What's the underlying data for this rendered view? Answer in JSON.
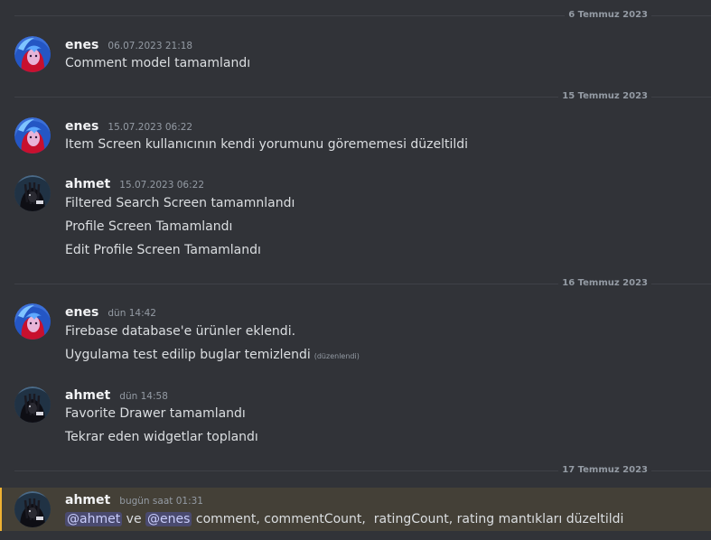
{
  "dividers": [
    "6 Temmuz 2023",
    "15 Temmuz 2023",
    "16 Temmuz 2023",
    "17 Temmuz 2023"
  ],
  "messages": [
    {
      "author": "enes",
      "timestamp": "06.07.2023 21:18",
      "lines": [
        "Comment model tamamlandı"
      ]
    },
    {
      "author": "enes",
      "timestamp": "15.07.2023 06:22",
      "lines": [
        "Item Screen kullanıcının kendi yorumunu görememesi düzeltildi"
      ]
    },
    {
      "author": "ahmet",
      "timestamp": "15.07.2023 06:22",
      "lines": [
        "Filtered Search Screen tamamnlandı",
        "Profile Screen Tamamlandı",
        "Edit Profile Screen Tamamlandı"
      ]
    },
    {
      "author": "enes",
      "timestamp": "dün 14:42",
      "lines": [
        "Firebase database'e ürünler eklendi.",
        "Uygulama test edilip buglar temizlendi"
      ],
      "edited_label": "(düzenlendi)"
    },
    {
      "author": "ahmet",
      "timestamp": "dün 14:58",
      "lines": [
        "Favorite Drawer tamamlandı",
        "Tekrar eden widgetlar toplandı"
      ]
    },
    {
      "author": "ahmet",
      "timestamp": "bugün saat 01:31",
      "mention_1": "@ahmet",
      "connector": "ve",
      "mention_2": "@enes",
      "text": "comment, commentCount,  ratingCount, rating mantıkları düzeltildi"
    }
  ],
  "colors": {
    "background": "#313338",
    "mention_highlight": "#444037",
    "mention_bar": "#f0b232",
    "mention_chip": "#5865f2"
  },
  "icons": {
    "enes_avatar": "avatar-enes-icon",
    "ahmet_avatar": "avatar-ahmet-icon"
  }
}
